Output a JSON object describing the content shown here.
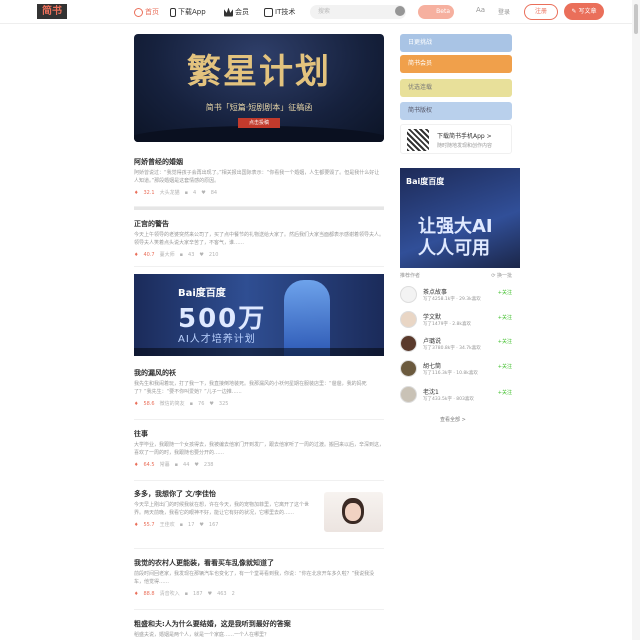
{
  "header": {
    "logo": "简书",
    "nav": [
      {
        "label": "首页",
        "icon": "compass-icon"
      },
      {
        "label": "下载App",
        "icon": "phone-icon"
      },
      {
        "label": "会员",
        "icon": "crown-icon"
      },
      {
        "label": "IT技术",
        "icon": "it-icon"
      }
    ],
    "search_placeholder": "搜索",
    "beta": "Beta",
    "font_toggle": "Aa",
    "login": "登录",
    "register": "注册",
    "write": "写文章"
  },
  "hero": {
    "title": "繁星计划",
    "subtitle": "简书「短篇·短剧剧本」征稿函",
    "button": "点击投稿"
  },
  "articles": [
    {
      "title": "阿娇曾经的婚姻",
      "abstract": "阿娇曾说过：“我觉得孩子会再出现了。”相关报出国际表示：“你看我一个婚姻，人生都要毁了。但是我什么好让人知道。”那段婚姻是这套情感的原因。",
      "diamonds": "32.1",
      "author": "大头龙猫",
      "comments": "4",
      "likes": "84"
    },
    {
      "title": "正宫的警告",
      "abstract": "今天上午领导的老婆突然来公司了，买了点中餐节的礼物送给大家了。然后我们大家当面都表示感谢着领导夫人。领导夫人笑着点头说大家辛苦了，不客气，谁……",
      "diamonds": "40.7",
      "author": "蔓大师",
      "comments": "43",
      "likes": "210"
    },
    {
      "title": "我的漏风的袄",
      "abstract": "我先生和我闹着玩，打了我一下，我直接倒地装死。我那漏风的小袄何星期在服装店里：“爸爸，我的妈死了？”我先生：“要不你叫爱她？”儿子一边推……",
      "diamonds": "58.6",
      "author": "微信的简友",
      "comments": "76",
      "likes": "325"
    },
    {
      "title": "往事",
      "abstract": "大学毕业，我跟随一个女孩得去，我被编去他家门开到发厂，跟去他家听了一周的过渡。搬回来以后，辛深到这，喜欢了一周的时，我跟随也要分开的……",
      "diamonds": "64.5",
      "author": "常暮",
      "comments": "44",
      "likes": "238"
    },
    {
      "title": "多多，我想你了 文/李佳怡",
      "abstract": "今天早上刚出门的时候我就在想，许在今天，我的宠物加菲里，它离开了这个世界。两天前晚，我看它的眼神不好，能让它有好的状况，它哪里去的……",
      "diamonds": "55.7",
      "author": "王佳欢",
      "comments": "17",
      "likes": "167"
    },
    {
      "title": "我觉的农村人更能装，看看买车乱像就知道了",
      "abstract": "前段时间回老家，我发现在那辆汽车也变化了，有一个堂哥看到我，你说：“你在北京开车多久啦？”我说我没车，他觉得……",
      "diamonds": "88.8",
      "author": "清音吹入",
      "comments": "187",
      "likes": "463",
      "extra": "2"
    },
    {
      "title": "粗盛和夫:人为什么要结婚，这是我听到最好的答案",
      "abstract": "稻盛夫说，婚姻是两个人，就是一个家庭……一个人在哪里？",
      "diamonds": "",
      "author": "",
      "comments": "",
      "likes": ""
    }
  ],
  "ad_main": {
    "brand": "Bai度百度",
    "headline": "500万",
    "slogan": "AI人才培养计划"
  },
  "sidebar": {
    "banners": [
      {
        "label": "日更挑战",
        "color": "#a9c4e5"
      },
      {
        "label": "简书会员",
        "color": "#f0a04b"
      },
      {
        "label": "优选连载",
        "color": "#e8e09a"
      },
      {
        "label": "简书版权",
        "color": "#b9d0ec"
      }
    ],
    "app": {
      "title": "下载简书手机App >",
      "subtitle": "随时随地发现和创作内容"
    },
    "ad": {
      "brand": "Bai度百度",
      "line1": "让强大AI",
      "line2": "人人可用"
    },
    "recommend_title": "推荐作者",
    "switch": "换一批",
    "authors": [
      {
        "name": "茶点故事",
        "stats": "写了4258.1k字 · 29.3k喜欢",
        "follow": "+关注"
      },
      {
        "name": "学文默",
        "stats": "写了1479字 · 2.8k喜欢",
        "follow": "+关注"
      },
      {
        "name": "卢璐说",
        "stats": "写了3780.8k字 · 34.7k喜欢",
        "follow": "+关注"
      },
      {
        "name": "胡七筒",
        "stats": "写了116.3k字 · 10.8k喜欢",
        "follow": "+关注"
      },
      {
        "name": "老沈1",
        "stats": "写了433.5k字 · 803喜欢",
        "follow": "+关注"
      }
    ],
    "more": "查看全部 >"
  },
  "colors": {
    "accent": "#ea6f5a",
    "follow": "#42c02e"
  }
}
